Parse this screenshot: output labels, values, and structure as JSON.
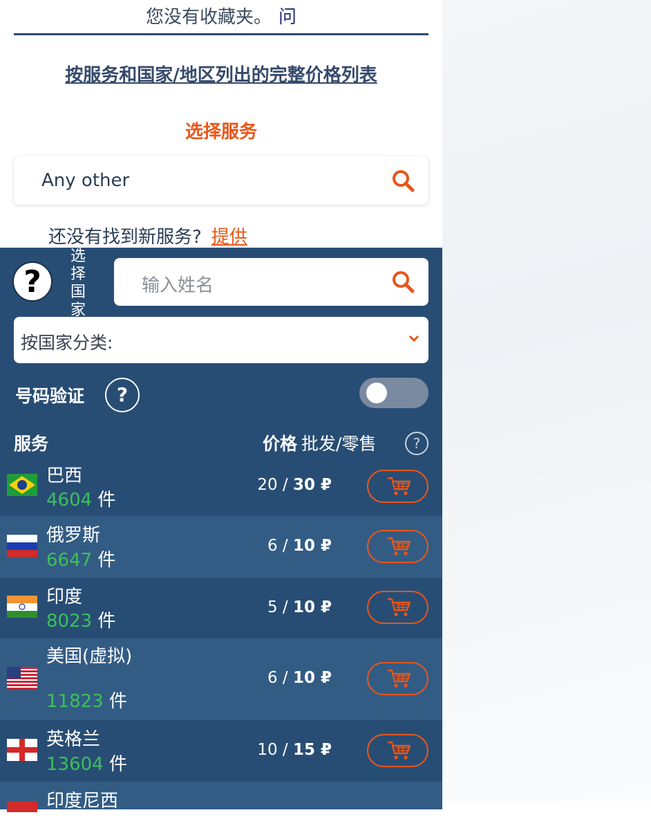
{
  "favorites": {
    "message": "您没有收藏夹。",
    "question_link": "问"
  },
  "price_list_link": "按服务和国家/地区列出的完整价格列表",
  "select_service": {
    "heading": "选择服务",
    "value": "Any other",
    "search_icon": "search-icon"
  },
  "not_found": {
    "text": "还没有找到新服务?",
    "offer_link": "提供"
  },
  "country_panel": {
    "help_icon": "help-icon",
    "vertical_label": "选择国家",
    "name_input_placeholder": "输入姓名",
    "sort_label": "按国家分类:",
    "verification_label": "号码验证",
    "verification_enabled": false,
    "header_service": "服务",
    "header_price": "价格",
    "header_price_sub": "批发/零售",
    "header_help": "?"
  },
  "countries": [
    {
      "name": "巴西",
      "count": "4604",
      "unit": "件",
      "wholesale": "20",
      "retail": "30",
      "currency": "₽",
      "flag": "brazil"
    },
    {
      "name": "俄罗斯",
      "count": "6647",
      "unit": "件",
      "wholesale": "6",
      "retail": "10",
      "currency": "₽",
      "flag": "russia"
    },
    {
      "name": "印度",
      "count": "8023",
      "unit": "件",
      "wholesale": "5",
      "retail": "10",
      "currency": "₽",
      "flag": "india"
    },
    {
      "name": "美国(虚拟)",
      "count": "11823",
      "unit": "件",
      "wholesale": "6",
      "retail": "10",
      "currency": "₽",
      "flag": "usa"
    },
    {
      "name": "英格兰",
      "count": "13604",
      "unit": "件",
      "wholesale": "10",
      "retail": "15",
      "currency": "₽",
      "flag": "england"
    },
    {
      "name": "印度尼西",
      "flag": "indonesia"
    }
  ],
  "colors": {
    "accent": "#e8561a",
    "panel": "#284d74",
    "panel_alt": "#335c84",
    "count": "#3cc05a"
  }
}
